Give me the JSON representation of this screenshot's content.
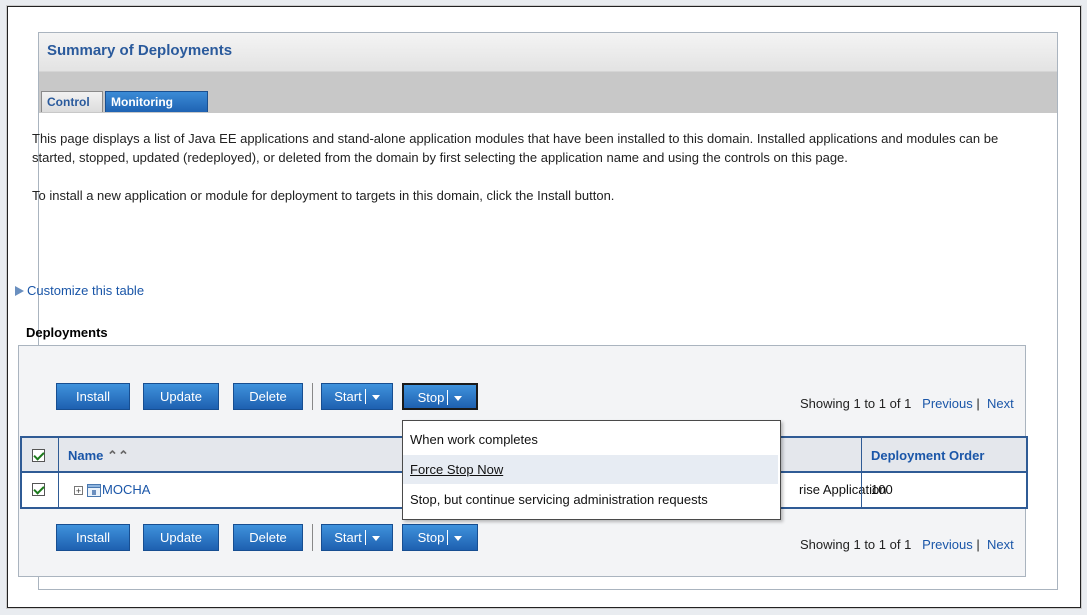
{
  "title": "Summary of Deployments",
  "tabs": [
    {
      "label": "Control",
      "active": false
    },
    {
      "label": "Monitoring",
      "active": true
    }
  ],
  "description": [
    "This page displays a list of Java EE applications and stand-alone application modules that have been installed to this domain. Installed applications and modules can be started, stopped, updated (redeployed), or deleted from the domain by first selecting the application name and using the controls on this page.",
    "To install a new application or module for deployment to targets in this domain, click the Install button."
  ],
  "customize_link": "Customize this table",
  "deployments_label": "Deployments",
  "toolbar": {
    "install": "Install",
    "update": "Update",
    "delete": "Delete",
    "start": "Start",
    "stop": "Stop"
  },
  "paging": {
    "showing": "Showing 1 to 1 of 1",
    "previous": "Previous",
    "next": "Next"
  },
  "table": {
    "columns": [
      "Name",
      "Deployment Order"
    ],
    "rows": [
      {
        "name": "MOCHA",
        "type_partial": "rise Application",
        "order": "100",
        "checked": true
      }
    ]
  },
  "stop_menu": [
    "When work completes",
    "Force Stop Now",
    "Stop, but continue servicing administration requests"
  ],
  "colors": {
    "accent": "#2a5a9c",
    "button": "#1e60b0",
    "grid_border": "#2f5b95"
  }
}
